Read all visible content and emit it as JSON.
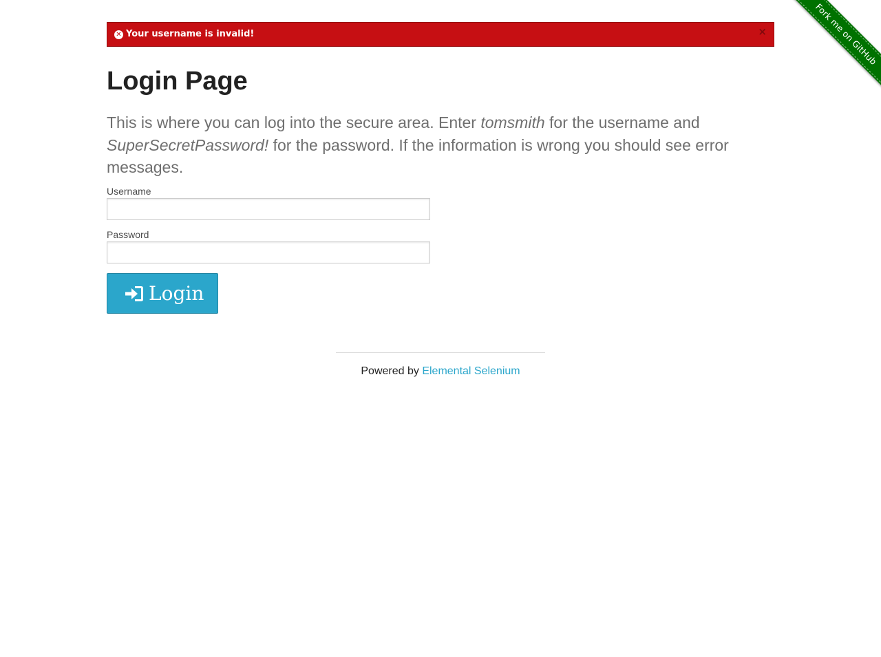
{
  "ribbon": {
    "label": "Fork me on GitHub"
  },
  "flash": {
    "message": "Your username is invalid!",
    "icon": "error-circle-icon",
    "close_label": "×",
    "color": "#c60f13"
  },
  "page": {
    "title": "Login Page",
    "intro_part1": "This is where you can log into the secure area. Enter ",
    "username_hint": "tomsmith",
    "intro_part2": " for the username and ",
    "password_hint": "SuperSecretPassword!",
    "intro_part3": " for the password. If the information is wrong you should see error messages."
  },
  "form": {
    "username_label": "Username",
    "username_value": "",
    "password_label": "Password",
    "password_value": "",
    "submit_label": "Login",
    "submit_icon": "sign-in-icon",
    "button_color": "#2ba6cb"
  },
  "footer": {
    "prefix": "Powered by ",
    "link_text": "Elemental Selenium",
    "link_color": "#2ba6cb"
  }
}
